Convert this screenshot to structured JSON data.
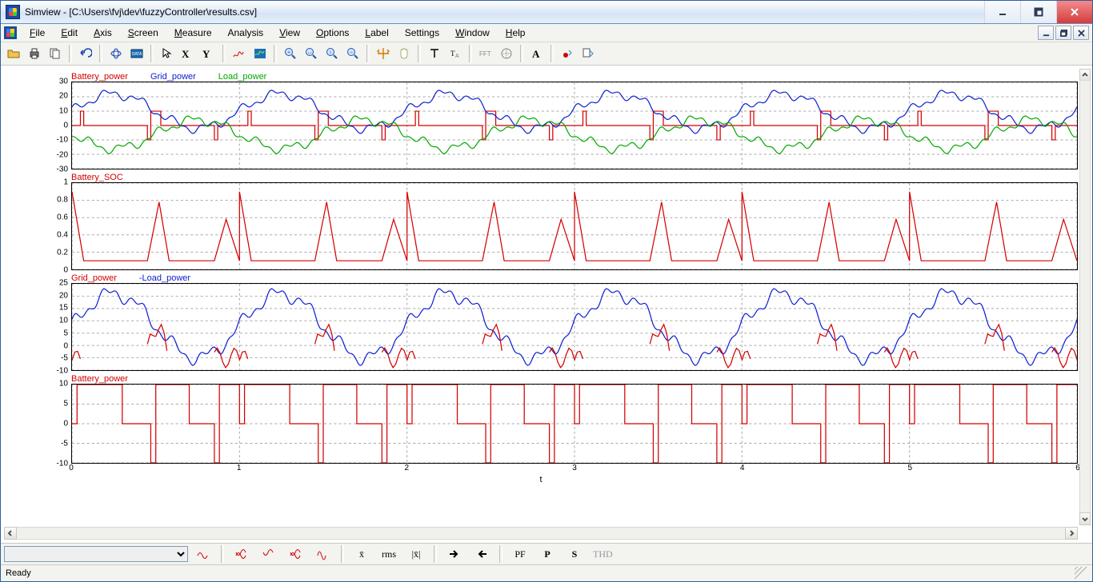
{
  "title": "Simview - [C:\\Users\\fvj\\dev\\fuzzyController\\results.csv]",
  "menu": {
    "file": "File",
    "edit": "Edit",
    "axis": "Axis",
    "screen": "Screen",
    "measure": "Measure",
    "analysis": "Analysis",
    "view": "View",
    "option": "Options",
    "label": "Label",
    "settings": "Settings",
    "window_": "Window",
    "help": "Help"
  },
  "toolbar_names": [
    "open-icon",
    "print-icon",
    "copy-icon",
    "|",
    "undo-icon",
    "|",
    "refresh-icon",
    "data-icon",
    "|",
    "pointer-icon",
    "x-cursor-icon",
    "y-cursor-icon",
    "|",
    "zoom-auto-icon",
    "zoom-fit-icon",
    "|",
    "zoom-in-icon",
    "zoom-x-in-icon",
    "zoom-y-in-icon",
    "zoom-out-icon",
    "|",
    "pan-icon",
    "hand-icon",
    "|",
    "text-tool-icon",
    "text-props-icon",
    "|",
    "fft-icon",
    "scope-icon",
    "|",
    "font-icon",
    "|",
    "record-icon",
    "export-icon"
  ],
  "funcbar_names": [
    "wave-add-icon",
    "|",
    "wave-sum-icon",
    "wave-prod-icon",
    "wave-abs-icon",
    "wave-sq-icon",
    "|",
    "avg-label",
    "rms-label",
    "absavg-label",
    "|",
    "next-cycle-icon",
    "prev-cycle-icon",
    "|",
    "pf-label",
    "p-label",
    "s-label",
    "thd-label"
  ],
  "funcbar_text": {
    "avg": "x̄",
    "rms": "rms",
    "absavg": "|x̄|",
    "pf": "PF",
    "p": "P",
    "s": "S",
    "thd": "THD"
  },
  "status": "Ready",
  "xaxis_label": "t",
  "chart_data": [
    {
      "title_series": [
        "Battery_power",
        "Grid_power",
        "Load_power"
      ],
      "title_colors": [
        "red",
        "blue",
        "green"
      ],
      "ylim": [
        -30,
        30
      ],
      "yticks": [
        -30,
        -20,
        -10,
        0,
        10,
        20,
        30
      ],
      "series": [
        {
          "name": "Battery_power",
          "color": "red",
          "type": "step",
          "period": 1.0,
          "segments": [
            [
              0,
              0.05,
              0
            ],
            [
              0.05,
              0.07,
              10
            ],
            [
              0.07,
              0.45,
              0
            ],
            [
              0.45,
              0.47,
              -10
            ],
            [
              0.47,
              0.53,
              10
            ],
            [
              0.53,
              0.85,
              0
            ],
            [
              0.85,
              0.87,
              -10
            ],
            [
              0.87,
              1.0,
              0
            ]
          ]
        },
        {
          "name": "Grid_power",
          "color": "blue",
          "type": "smooth",
          "period": 1.0,
          "base": 10,
          "amp": 12,
          "phase": 0.0,
          "noise": 2.5
        },
        {
          "name": "Load_power",
          "color": "green",
          "type": "smooth",
          "period": 1.0,
          "base": -6,
          "amp": 10,
          "phase": 0.5,
          "noise": 2.5
        }
      ]
    },
    {
      "title_series": [
        "Battery_SOC"
      ],
      "title_colors": [
        "red"
      ],
      "ylim": [
        0,
        1
      ],
      "yticks": [
        0,
        0.2,
        0.4,
        0.6,
        0.8,
        1
      ],
      "series": [
        {
          "name": "Battery_SOC",
          "color": "red",
          "type": "piecewise",
          "period": 1.0,
          "points": [
            [
              0.0,
              0.9
            ],
            [
              0.07,
              0.1
            ],
            [
              0.45,
              0.1
            ],
            [
              0.52,
              0.78
            ],
            [
              0.58,
              0.1
            ],
            [
              0.85,
              0.1
            ],
            [
              0.92,
              0.58
            ],
            [
              1.0,
              0.1
            ]
          ]
        }
      ]
    },
    {
      "title_series": [
        "Grid_power",
        "-Load_power"
      ],
      "title_colors": [
        "red",
        "blue"
      ],
      "ylim": [
        -10,
        25
      ],
      "yticks": [
        -10,
        -5,
        0,
        5,
        10,
        15,
        20,
        25
      ],
      "series": [
        {
          "name": "-Load_power",
          "color": "blue",
          "type": "smooth",
          "period": 1.0,
          "base": 8,
          "amp": 13,
          "phase": 0.0,
          "noise": 2.2
        },
        {
          "name": "Grid_power",
          "color": "red",
          "type": "gridred",
          "period": 1.0
        }
      ]
    },
    {
      "title_series": [
        "Battery_power"
      ],
      "title_colors": [
        "red"
      ],
      "ylim": [
        -10,
        10
      ],
      "yticks": [
        -10,
        -5,
        0,
        5,
        10
      ],
      "series": [
        {
          "name": "Battery_power",
          "color": "red",
          "type": "step",
          "period": 1.0,
          "segments": [
            [
              0.0,
              0.03,
              0
            ],
            [
              0.03,
              0.3,
              10
            ],
            [
              0.3,
              0.47,
              0
            ],
            [
              0.47,
              0.5,
              -10
            ],
            [
              0.5,
              0.7,
              10
            ],
            [
              0.7,
              0.85,
              0
            ],
            [
              0.85,
              0.88,
              -10
            ],
            [
              0.88,
              1.0,
              10
            ]
          ]
        }
      ]
    }
  ],
  "xrange": [
    0,
    6
  ],
  "xticks": [
    0,
    1,
    2,
    3,
    4,
    5,
    6
  ]
}
